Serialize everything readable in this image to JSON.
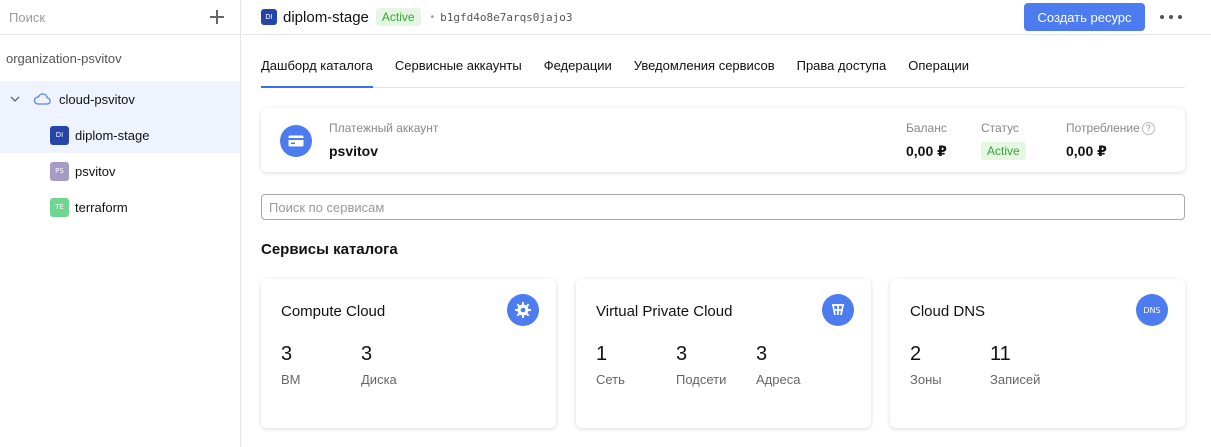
{
  "sidebar": {
    "search_placeholder": "Поиск",
    "organization": "organization-psvitov",
    "cloud": "cloud-psvitov",
    "folders": [
      {
        "badge": "DI",
        "name": "diplom-stage",
        "color": "#2545a8"
      },
      {
        "badge": "PS",
        "name": "psvitov",
        "color": "#a69bc6"
      },
      {
        "badge": "TE",
        "name": "terraform",
        "color": "#6fd68f"
      }
    ]
  },
  "header": {
    "badge": "DI",
    "folder_name": "diplom-stage",
    "status": "Active",
    "folder_id": "b1gfd4o8e7arqs0jajo3",
    "create_button": "Создать ресурс"
  },
  "tabs": [
    {
      "label": "Дашборд каталога"
    },
    {
      "label": "Сервисные аккаунты"
    },
    {
      "label": "Федерации"
    },
    {
      "label": "Уведомления сервисов"
    },
    {
      "label": "Права доступа"
    },
    {
      "label": "Операции"
    }
  ],
  "billing": {
    "label": "Платежный аккаунт",
    "name": "psvitov",
    "balance_label": "Баланс",
    "balance_value": "0,00 ₽",
    "status_label": "Статус",
    "status_value": "Active",
    "consumption_label": "Потребление",
    "consumption_value": "0,00 ₽",
    "help_icon": "?"
  },
  "services_search_placeholder": "Поиск по сервисам",
  "section_title": "Сервисы каталога",
  "cards": [
    {
      "title": "Compute Cloud",
      "icon": "compute-icon",
      "metrics": [
        {
          "value": "3",
          "label": "ВМ"
        },
        {
          "value": "3",
          "label": "Диска"
        }
      ]
    },
    {
      "title": "Virtual Private Cloud",
      "icon": "vpc-icon",
      "metrics": [
        {
          "value": "1",
          "label": "Сеть"
        },
        {
          "value": "3",
          "label": "Подсети"
        },
        {
          "value": "3",
          "label": "Адреса"
        }
      ]
    },
    {
      "title": "Cloud DNS",
      "icon": "dns-icon",
      "icon_text": "DNS",
      "metrics": [
        {
          "value": "2",
          "label": "Зоны"
        },
        {
          "value": "11",
          "label": "Записей"
        }
      ]
    }
  ]
}
